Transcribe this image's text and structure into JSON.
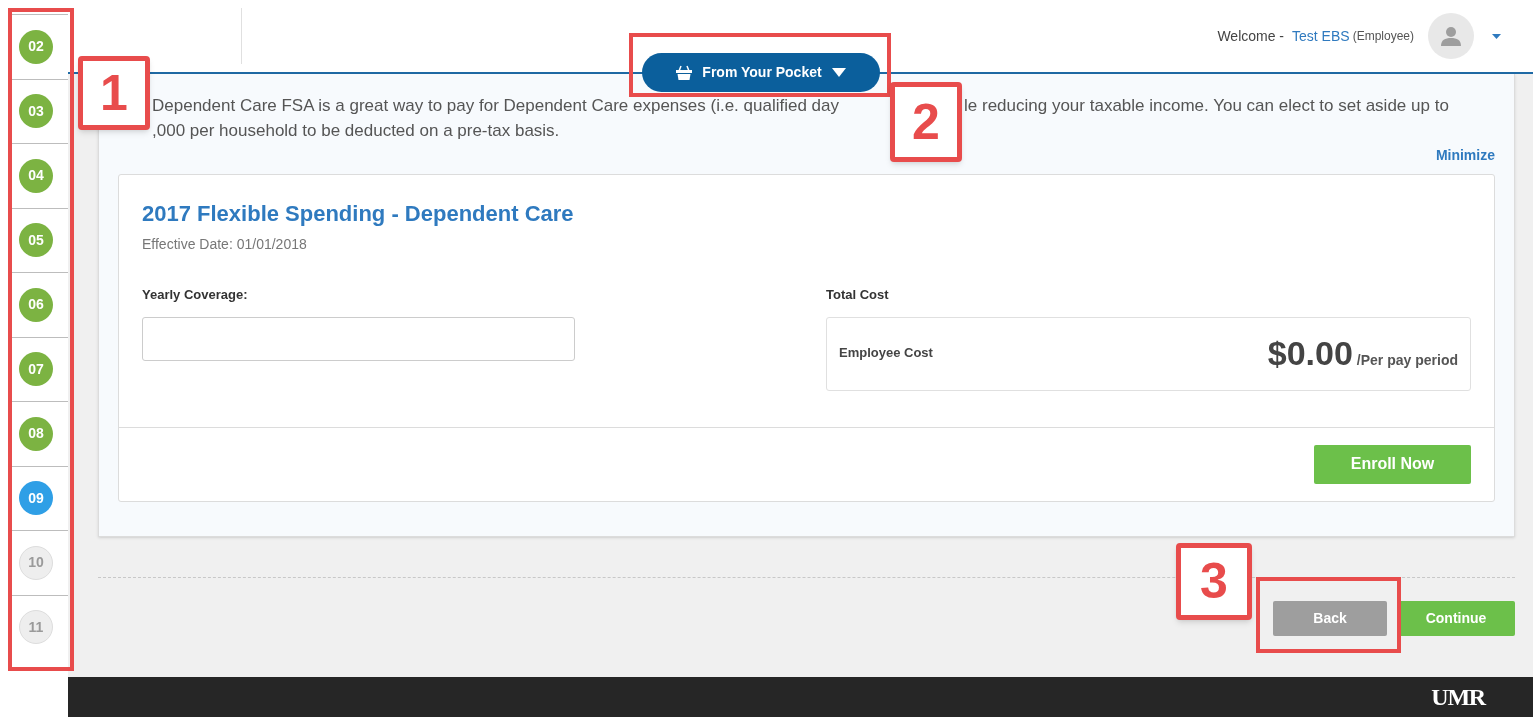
{
  "steps": [
    {
      "label": "02",
      "kind": "complete"
    },
    {
      "label": "03",
      "kind": "complete"
    },
    {
      "label": "04",
      "kind": "complete"
    },
    {
      "label": "05",
      "kind": "complete"
    },
    {
      "label": "06",
      "kind": "complete"
    },
    {
      "label": "07",
      "kind": "complete"
    },
    {
      "label": "08",
      "kind": "complete"
    },
    {
      "label": "09",
      "kind": "current"
    },
    {
      "label": "10",
      "kind": "pending"
    },
    {
      "label": "11",
      "kind": "pending"
    }
  ],
  "header": {
    "welcome": "Welcome -",
    "user_name": "Test EBS",
    "role": "(Employee)"
  },
  "category_button": {
    "label": "From Your Pocket"
  },
  "intro": {
    "line_1a": "Dependent Care FSA is a great way to pay for Dependent Care expenses (i.e. qualified day",
    "line_1b": "le reducing your taxable income. You can elect to set aside up to",
    "line_2": ",000 per household to be deducted on a pre-tax basis."
  },
  "minimize_link": "Minimize",
  "plan": {
    "title": "2017 Flexible Spending - Dependent Care",
    "effective_date": "Effective Date: 01/01/2018",
    "coverage_label": "Yearly Coverage:",
    "total_cost_label": "Total Cost",
    "employee_cost_label": "Employee Cost",
    "amount": "$0.00",
    "period": "/Per pay period",
    "enroll_button": "Enroll Now"
  },
  "nav_buttons": {
    "back": "Back",
    "continue": "Continue"
  },
  "footer": {
    "logo": "UMR"
  },
  "callouts": [
    {
      "label": "1"
    },
    {
      "label": "2"
    },
    {
      "label": "3"
    }
  ]
}
